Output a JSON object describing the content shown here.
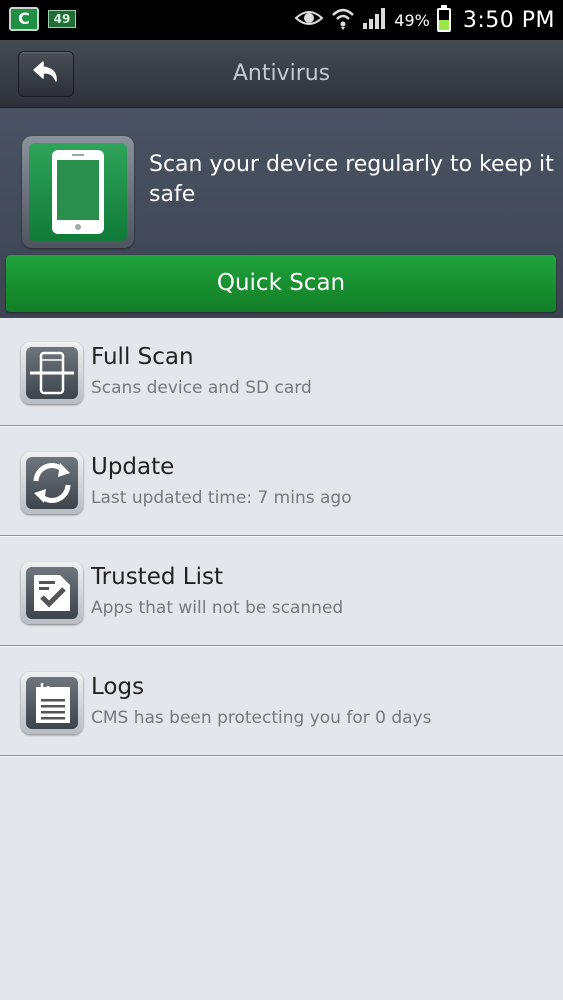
{
  "status_bar": {
    "app_icon_letter": "C",
    "notification_badge": "49",
    "battery_percent": "49%",
    "time": "3:50 PM",
    "icons": [
      "eye-icon",
      "wifi-icon",
      "signal-icon",
      "battery-icon"
    ]
  },
  "header": {
    "title": "Antivirus",
    "back_icon": "back-arrow-icon"
  },
  "banner": {
    "message": "Scan your device regularly to keep it safe",
    "icon": "phone-icon",
    "quick_scan_label": "Quick Scan",
    "accent_color": "#1a9433"
  },
  "menu": {
    "items": [
      {
        "title": "Full Scan",
        "subtitle": "Scans device and SD card",
        "icon": "phone-scan-icon"
      },
      {
        "title": "Update",
        "subtitle": "Last updated time: 7 mins ago",
        "icon": "refresh-icon"
      },
      {
        "title": "Trusted List",
        "subtitle": "Apps that will not be scanned",
        "icon": "checklist-icon"
      },
      {
        "title": "Logs",
        "subtitle": "CMS has been protecting you for 0 days",
        "icon": "document-clip-icon"
      }
    ]
  }
}
